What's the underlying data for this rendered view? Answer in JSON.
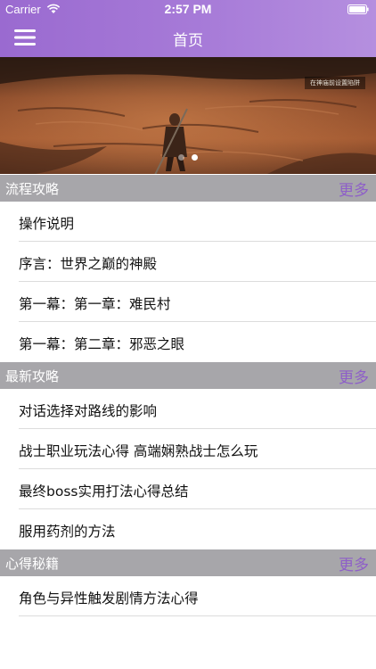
{
  "status_bar": {
    "carrier": "Carrier",
    "time": "2:57 PM"
  },
  "nav": {
    "title": "首页",
    "menu_icon": "hamburger-menu-icon"
  },
  "banner": {
    "caption": "在神庙前设置陷阱",
    "page_count": 2,
    "active_page": 2
  },
  "sections": [
    {
      "title": "流程攻略",
      "more": "更多",
      "items": [
        "操作说明",
        "序言：世界之巅的神殿",
        "第一幕：第一章：难民村",
        "第一幕：第二章：邪恶之眼"
      ]
    },
    {
      "title": "最新攻略",
      "more": "更多",
      "items": [
        "对话选择对路线的影响",
        "战士职业玩法心得 高端娴熟战士怎么玩",
        "最终boss实用打法心得总结",
        "服用药剂的方法"
      ]
    },
    {
      "title": "心得秘籍",
      "more": "更多",
      "items": [
        "角色与异性触发剧情方法心得"
      ]
    }
  ],
  "colors": {
    "nav_gradient_start": "#9a6ad0",
    "nav_gradient_end": "#b58fdf",
    "section_header_bg": "#a7a6aa",
    "more_link": "#8e5fc8"
  }
}
